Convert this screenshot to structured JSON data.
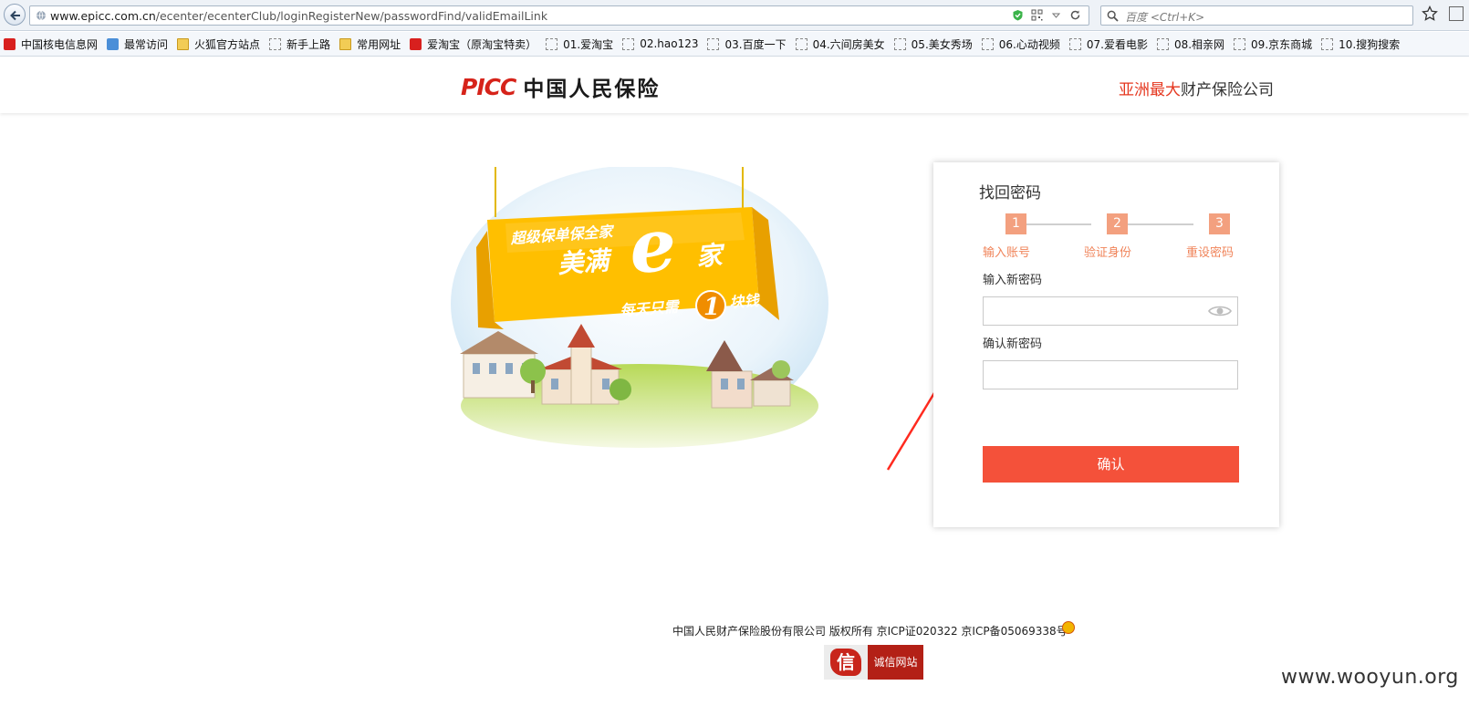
{
  "browser": {
    "url_host": "www.epicc.com.cn",
    "url_path": "/ecenter/ecenterClub/loginRegisterNew/passwordFind/validEmailLink",
    "search_placeholder": "百度 <Ctrl+K>"
  },
  "bookmarks": [
    {
      "label": "中国核电信息网",
      "icon": "red"
    },
    {
      "label": "最常访问",
      "icon": "blue"
    },
    {
      "label": "火狐官方站点",
      "icon": "folder"
    },
    {
      "label": "新手上路",
      "icon": "dashed"
    },
    {
      "label": "常用网址",
      "icon": "folder"
    },
    {
      "label": "爱淘宝（原淘宝特卖）",
      "icon": "red"
    },
    {
      "label": "01.爱淘宝",
      "icon": "dashed"
    },
    {
      "label": "02.hao123",
      "icon": "dashed"
    },
    {
      "label": "03.百度一下",
      "icon": "dashed"
    },
    {
      "label": "04.六间房美女",
      "icon": "dashed"
    },
    {
      "label": "05.美女秀场",
      "icon": "dashed"
    },
    {
      "label": "06.心动视频",
      "icon": "dashed"
    },
    {
      "label": "07.爱看电影",
      "icon": "dashed"
    },
    {
      "label": "08.相亲网",
      "icon": "dashed"
    },
    {
      "label": "09.京东商城",
      "icon": "dashed"
    },
    {
      "label": "10.搜狗搜索",
      "icon": "dashed"
    }
  ],
  "header": {
    "logo_en": "PICC",
    "logo_cn": "中国人民保险",
    "slogan_highlight": "亚洲最大",
    "slogan_rest": "财产保险公司"
  },
  "banner": {
    "line1": "超级保单保全家",
    "line2": "美满",
    "big_letter": "e",
    "line2b": "家",
    "line3a": "每天只需",
    "number": "1",
    "line3b": "块钱"
  },
  "form": {
    "title": "找回密码",
    "steps": [
      {
        "num": "1",
        "label": "输入账号"
      },
      {
        "num": "2",
        "label": "验证身份"
      },
      {
        "num": "3",
        "label": "重设密码"
      }
    ],
    "new_password_label": "输入新密码",
    "confirm_password_label": "确认新密码",
    "submit_label": "确认"
  },
  "footer": {
    "copyright": "中国人民财产保险股份有限公司 版权所有 京ICP证020322 京ICP备05069338号",
    "trust_icon_char": "信",
    "trust_label": "诚信网站"
  },
  "watermark": "www.wooyun.org",
  "colors": {
    "accent": "#f4513a",
    "step": "#f3a07f",
    "brand_red": "#d6231a",
    "annotation": "#ff2a1f"
  }
}
